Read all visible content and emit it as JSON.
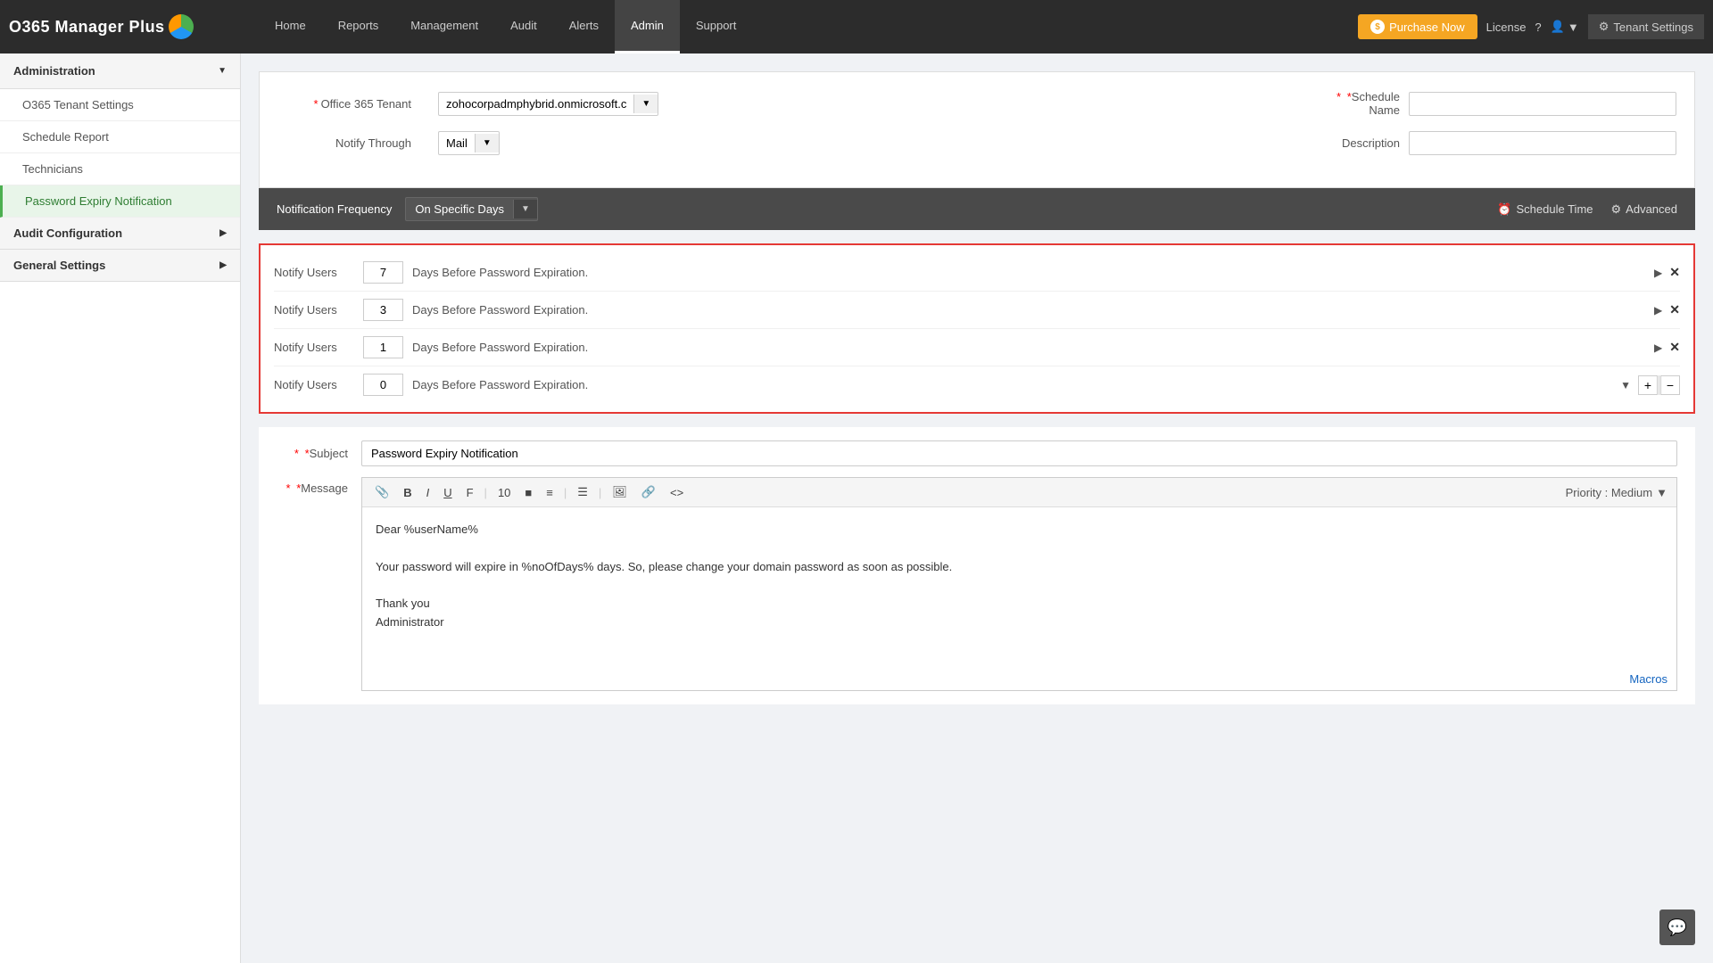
{
  "app": {
    "title": "O365 Manager Plus"
  },
  "topnav": {
    "links": [
      "Home",
      "Reports",
      "Management",
      "Audit",
      "Alerts",
      "Admin",
      "Support"
    ],
    "active": "Admin",
    "purchase_label": "Purchase Now",
    "license_label": "License",
    "tenant_settings_label": "Tenant Settings"
  },
  "sidebar": {
    "administration_label": "Administration",
    "items": [
      {
        "label": "O365 Tenant Settings",
        "active": false
      },
      {
        "label": "Schedule Report",
        "active": false
      },
      {
        "label": "Technicians",
        "active": false
      },
      {
        "label": "Password Expiry Notification",
        "active": true
      }
    ],
    "audit_config_label": "Audit Configuration",
    "general_settings_label": "General Settings"
  },
  "form": {
    "office365_tenant_label": "Office 365 Tenant",
    "office365_tenant_value": "zohocorpadmphybrid.onmicrosoft.c",
    "notify_through_label": "Notify Through",
    "notify_through_value": "Mail",
    "schedule_name_label": "Schedule Name",
    "schedule_name_value": "",
    "description_label": "Description",
    "description_value": ""
  },
  "notification": {
    "frequency_label": "Notification Frequency",
    "frequency_value": "On Specific Days",
    "schedule_time_label": "Schedule Time",
    "advanced_label": "Advanced",
    "rows": [
      {
        "prefix": "Notify Users",
        "value": "7",
        "suffix": "Days Before Password Expiration."
      },
      {
        "prefix": "Notify Users",
        "value": "3",
        "suffix": "Days Before Password Expiration."
      },
      {
        "prefix": "Notify Users",
        "value": "1",
        "suffix": "Days Before Password Expiration."
      },
      {
        "prefix": "Notify Users",
        "value": "0",
        "suffix": "Days Before Password Expiration."
      }
    ]
  },
  "message_editor": {
    "subject_label": "Subject",
    "subject_required": true,
    "subject_value": "Password Expiry Notification",
    "message_label": "Message",
    "message_required": true,
    "priority_label": "Priority : Medium",
    "body_line1": "Dear %userName%",
    "body_line2": "Your password will expire in %noOfDays% days. So, please change your domain password as soon as possible.",
    "body_line3": "Thank you",
    "body_line4": "Administrator",
    "macros_label": "Macros",
    "toolbar": {
      "attachment": "📎",
      "bold": "B",
      "italic": "I",
      "underline": "U",
      "font": "F",
      "font_size": "10",
      "color": "■",
      "align": "≡",
      "list": "☰",
      "image": "🖼",
      "link": "🔗",
      "code": "<>"
    }
  }
}
